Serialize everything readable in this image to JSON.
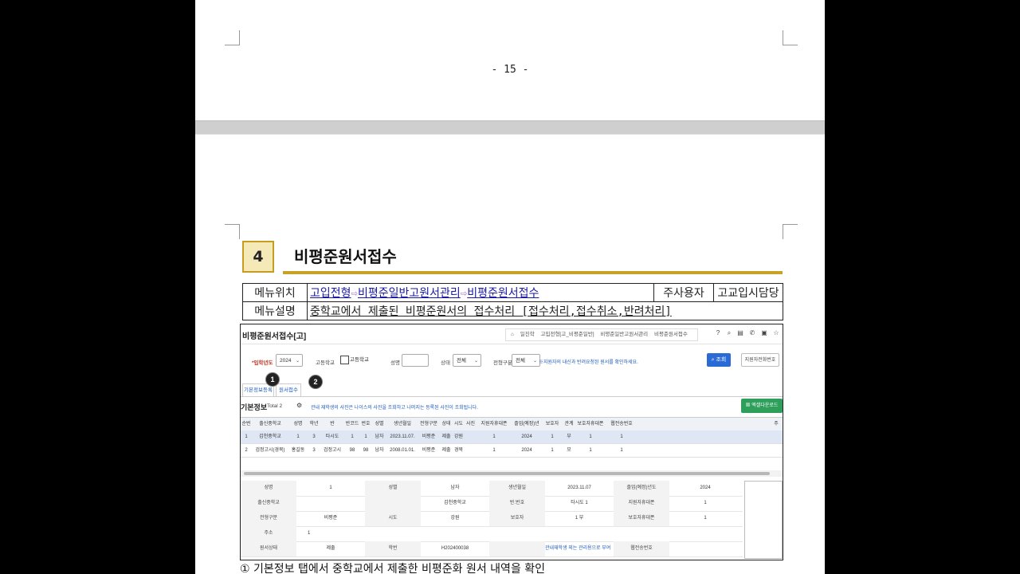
{
  "page_number": "- 15 -",
  "section": {
    "number": "4",
    "title": "비평준원서접수"
  },
  "info_table": {
    "menu_location_label": "메뉴위치",
    "menu_path": [
      "고입전형",
      "비평준일반고원서관리",
      "비평준원서접수"
    ],
    "path_arrow": "⇨",
    "main_user_label": "주사용자",
    "main_user_value": "고교입시담당",
    "menu_desc_label": "메뉴설명",
    "menu_desc_value": "중학교에서 제출된 비평준원서의 접수처리 [접수처리,접수취소,반려처리]"
  },
  "screenshot": {
    "title": "비평준원서접수[고]",
    "breadcrumbs": [
      "일진학",
      "고입전형[고_비평준일반]",
      "비평준일반고원서관리",
      "비평준원서접수"
    ],
    "filters": {
      "year_label": "*입학년도",
      "year_value": "2024",
      "school_label": "고등학교",
      "school_value": "고등학교",
      "name_label": "성명",
      "status_label": "상태",
      "status_value": "전체",
      "type_label": "전형구분",
      "type_value": "전체",
      "hint": "※지원자의 내신과 반려요청된 원서를 확인하세요.",
      "search_button": "조회",
      "extra_button": "지원자전화번호"
    },
    "tabs": [
      "기본정보등록",
      "원서접수"
    ],
    "markers": [
      "1",
      "2"
    ],
    "grid": {
      "title": "기본정보",
      "total": "Total 2",
      "note": "관내 재학생의 사진은 나이스의 사진을 조회하고 나머지는 등록된 사진이 조회됩니다.",
      "excel_button": "엑셀다운로드",
      "columns": [
        "순번",
        "출신중학교",
        "성명",
        "학년",
        "반",
        "반코드",
        "번호",
        "성별",
        "생년월일",
        "전형구분",
        "상태",
        "시도",
        "사진",
        "지원자휴대폰",
        "졸업(예정)년",
        "보호자",
        "관계",
        "보호자휴대폰",
        "웹전송번호",
        "주"
      ],
      "rows": [
        [
          "1",
          "갑천중학교",
          "1",
          "3",
          "타시도",
          "1",
          "1",
          "남자",
          "2023.11.07.",
          "비평준",
          "제출",
          "강원",
          "",
          "1",
          "2024",
          "1",
          "부",
          "1",
          "1",
          ""
        ],
        [
          "2",
          "검정고시(경북)",
          "홍길동",
          "3",
          "검정고시",
          "98",
          "98",
          "남자",
          "2008.01.01.",
          "비평준",
          "제출",
          "경북",
          "",
          "1",
          "2024",
          "1",
          "모",
          "1",
          "1",
          ""
        ]
      ]
    },
    "detail": {
      "rows": [
        [
          [
            "성명",
            "1"
          ],
          [
            "성별",
            "남자"
          ],
          [
            "생년월일",
            "2023.11.07"
          ],
          [
            "졸업(예정)년도",
            "2024"
          ]
        ],
        [
          [
            "출신중학교",
            ""
          ],
          [
            "",
            "갑천중학교"
          ],
          [
            "반.번호",
            "타시도  1"
          ],
          [
            "지원자휴대폰",
            "1"
          ]
        ],
        [
          [
            "전형구분",
            "비평준"
          ],
          [
            "시도",
            "강원"
          ],
          [
            "보호자",
            "1    부"
          ],
          [
            "보호자휴대폰",
            "1"
          ]
        ],
        [
          [
            "주소",
            "1"
          ]
        ],
        [
          [
            "원서상태",
            "제출"
          ],
          [
            "학번",
            "H202400038"
          ],
          [
            "",
            "관내재학생 외는 관리용으로 부여"
          ],
          [
            "웹전송번호",
            ""
          ]
        ]
      ]
    }
  },
  "caption": "① 기본정보 탭에서 중학교에서 제출한 비평준화 원서 내역을 확인"
}
